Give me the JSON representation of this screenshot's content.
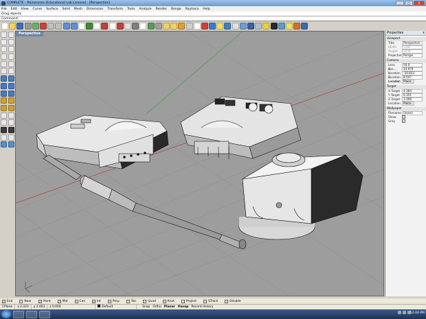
{
  "window": {
    "title": "COMPLETE - Rhinoceros (Educational Lab License) - [Perspective]",
    "buttons": {
      "minimize": "_",
      "maximize": "□",
      "close": "X"
    }
  },
  "menu": [
    "File",
    "Edit",
    "View",
    "Curve",
    "Surface",
    "Solid",
    "Mesh",
    "Dimension",
    "Transform",
    "Tools",
    "Analyze",
    "Render",
    "Bongo",
    "Rayhaca",
    "Help"
  ],
  "command": {
    "history": "Drag objects",
    "prompt": "Command:"
  },
  "toolbar_icons": [
    "new-icon",
    "open-icon",
    "save-icon",
    "print-icon",
    "import-icon",
    "cut-icon",
    "copy-icon",
    "paste-icon",
    "undo-icon",
    "redo-icon",
    "pan-icon",
    "rotate-view-icon",
    "zoom-icon",
    "zoom-window-icon",
    "zoom-extents-icon",
    "zoom-selected-icon",
    "undo-view-icon",
    "four-views-icon",
    "set-view-icon",
    "cplane-icon",
    "select-all-icon",
    "lock-icon",
    "show-icon",
    "hide-icon",
    "layer-icon",
    "properties-icon",
    "color-icon",
    "render-icon",
    "light-icon",
    "globe-icon",
    "analyze-icon",
    "shaded-icon",
    "rendered-icon",
    "shaded-solid-icon",
    "info-icon",
    "grid-icon",
    "gumball-icon",
    "bulb-icon",
    "tools-icon",
    "help-icon"
  ],
  "toolbar_colors": [
    "#ffffff",
    "#f6d25a",
    "#3f6fb5",
    "#999999",
    "#6ab06a",
    "#d04040",
    "#c0c0c0",
    "#c0c0c0",
    "#6090d0",
    "#6090d0",
    "#ffffff",
    "#3a8a3a",
    "#ffffff",
    "#c04040",
    "#ffffff",
    "#c04040",
    "#e0e0e0",
    "#808080",
    "#ffffff",
    "#5a9a5a",
    "#a0a0a0",
    "#f0d060",
    "#f0d060",
    "#e0a030",
    "#d0d0d0",
    "#ffffff",
    "#d04040",
    "#3a7ad0",
    "#f0e060",
    "#4080c0",
    "#e0e0e0",
    "#6aa0d0",
    "#3a60a0",
    "#b0c0d0",
    "#e8d040",
    "#2a2a2a",
    "#5a9ad0",
    "#f0e060",
    "#d07030",
    "#3a6ab0"
  ],
  "left_tools": [
    "point-icon",
    "line-icon",
    "polyline-icon",
    "curve-icon",
    "circle-icon",
    "arc-icon",
    "ellipse-icon",
    "rectangle-icon",
    "polygon-icon",
    "freeform-icon",
    "offset-icon",
    "fillet-icon",
    "surface-icon",
    "box-icon",
    "sphere-icon",
    "cylinder-icon",
    "extrude-icon",
    "loft-icon",
    "boolean-icon",
    "mesh-icon",
    "move-icon",
    "copy-icon",
    "rotate-icon",
    "scale-icon",
    "trim-icon",
    "split-icon",
    "join-icon",
    "explode-icon",
    "group-icon",
    "dimension-icon",
    "text-icon",
    "analyze-icon"
  ],
  "left_colors": [
    "#e8e8e8",
    "#e8e8e8",
    "#e8e8e8",
    "#e8e8e8",
    "#e8e8e8",
    "#e8e8e8",
    "#e8e8e8",
    "#e8e8e8",
    "#e8e8e8",
    "#e8e8e8",
    "#e8e8e8",
    "#e8e8e8",
    "#4a7ac0",
    "#4a7ac0",
    "#4a7ac0",
    "#4a7ac0",
    "#4a7ac0",
    "#4a7ac0",
    "#d0a030",
    "#d0a030",
    "#d0a030",
    "#d0a030",
    "#e8e8e8",
    "#e8e8e8",
    "#e8e8e8",
    "#e8e8e8",
    "#3a3a3a",
    "#3a3a3a",
    "#e8e8e8",
    "#e8e8e8",
    "#5090d0",
    "#5090d0"
  ],
  "viewport": {
    "label": "Perspective",
    "background": "#9d9d9d"
  },
  "properties": {
    "title": "Properties",
    "close": "x",
    "viewport_section": "Viewport",
    "title_label": "Title",
    "title_value": "Perspective",
    "width_label": "Width",
    "width_value": "1260",
    "height_label": "Height",
    "height_value": "1030",
    "projection_label": "Projection",
    "projection_value": "Perspe",
    "camera_section": "Camera",
    "lens_label": "Lens Len...",
    "lens_value": "50.0",
    "xloc_label": "X Location",
    "xloc_value": "14.974",
    "yloc_label": "Y Location",
    "yloc_value": "-10.853",
    "zloc_label": "Z Location",
    "zloc_value": "8.547",
    "location_label": "Location",
    "place_button": "Place...",
    "target_section": "Target",
    "xtarget_label": "X Target",
    "xtarget_value": "4.364",
    "ytarget_label": "Y Target",
    "ytarget_value": "0.351",
    "ztarget_label": "Z Target",
    "ztarget_value": "1.306",
    "tlocation_label": "Location",
    "tplace_button": "Place...",
    "wallpaper_section": "Wallpaper",
    "filename_label": "Filename",
    "filename_value": "(none)",
    "show_label": "Show",
    "show_check": "✓",
    "gray_label": "Gray",
    "gray_check": "✓"
  },
  "osnaps": [
    {
      "label": "End",
      "checked": true
    },
    {
      "label": "Near",
      "checked": false
    },
    {
      "label": "Point",
      "checked": true
    },
    {
      "label": "Mid",
      "checked": true
    },
    {
      "label": "Cen",
      "checked": false
    },
    {
      "label": "Int",
      "checked": true
    },
    {
      "label": "Perp",
      "checked": false
    },
    {
      "label": "Tan",
      "checked": false
    },
    {
      "label": "Quad",
      "checked": false
    },
    {
      "label": "Knot",
      "checked": false
    },
    {
      "label": "Project",
      "checked": false
    },
    {
      "label": "STrack",
      "checked": false
    },
    {
      "label": "Disable",
      "checked": false
    }
  ],
  "status": {
    "cplane": "CPlane",
    "x": "x 2.323",
    "y": "y 3.463",
    "z": "z 0.000",
    "layer": "Default",
    "panes": [
      "Snap",
      "Ortho",
      "Planar",
      "Osnap",
      "Record History"
    ]
  },
  "taskbar": {
    "clock": "12:44 PM"
  }
}
